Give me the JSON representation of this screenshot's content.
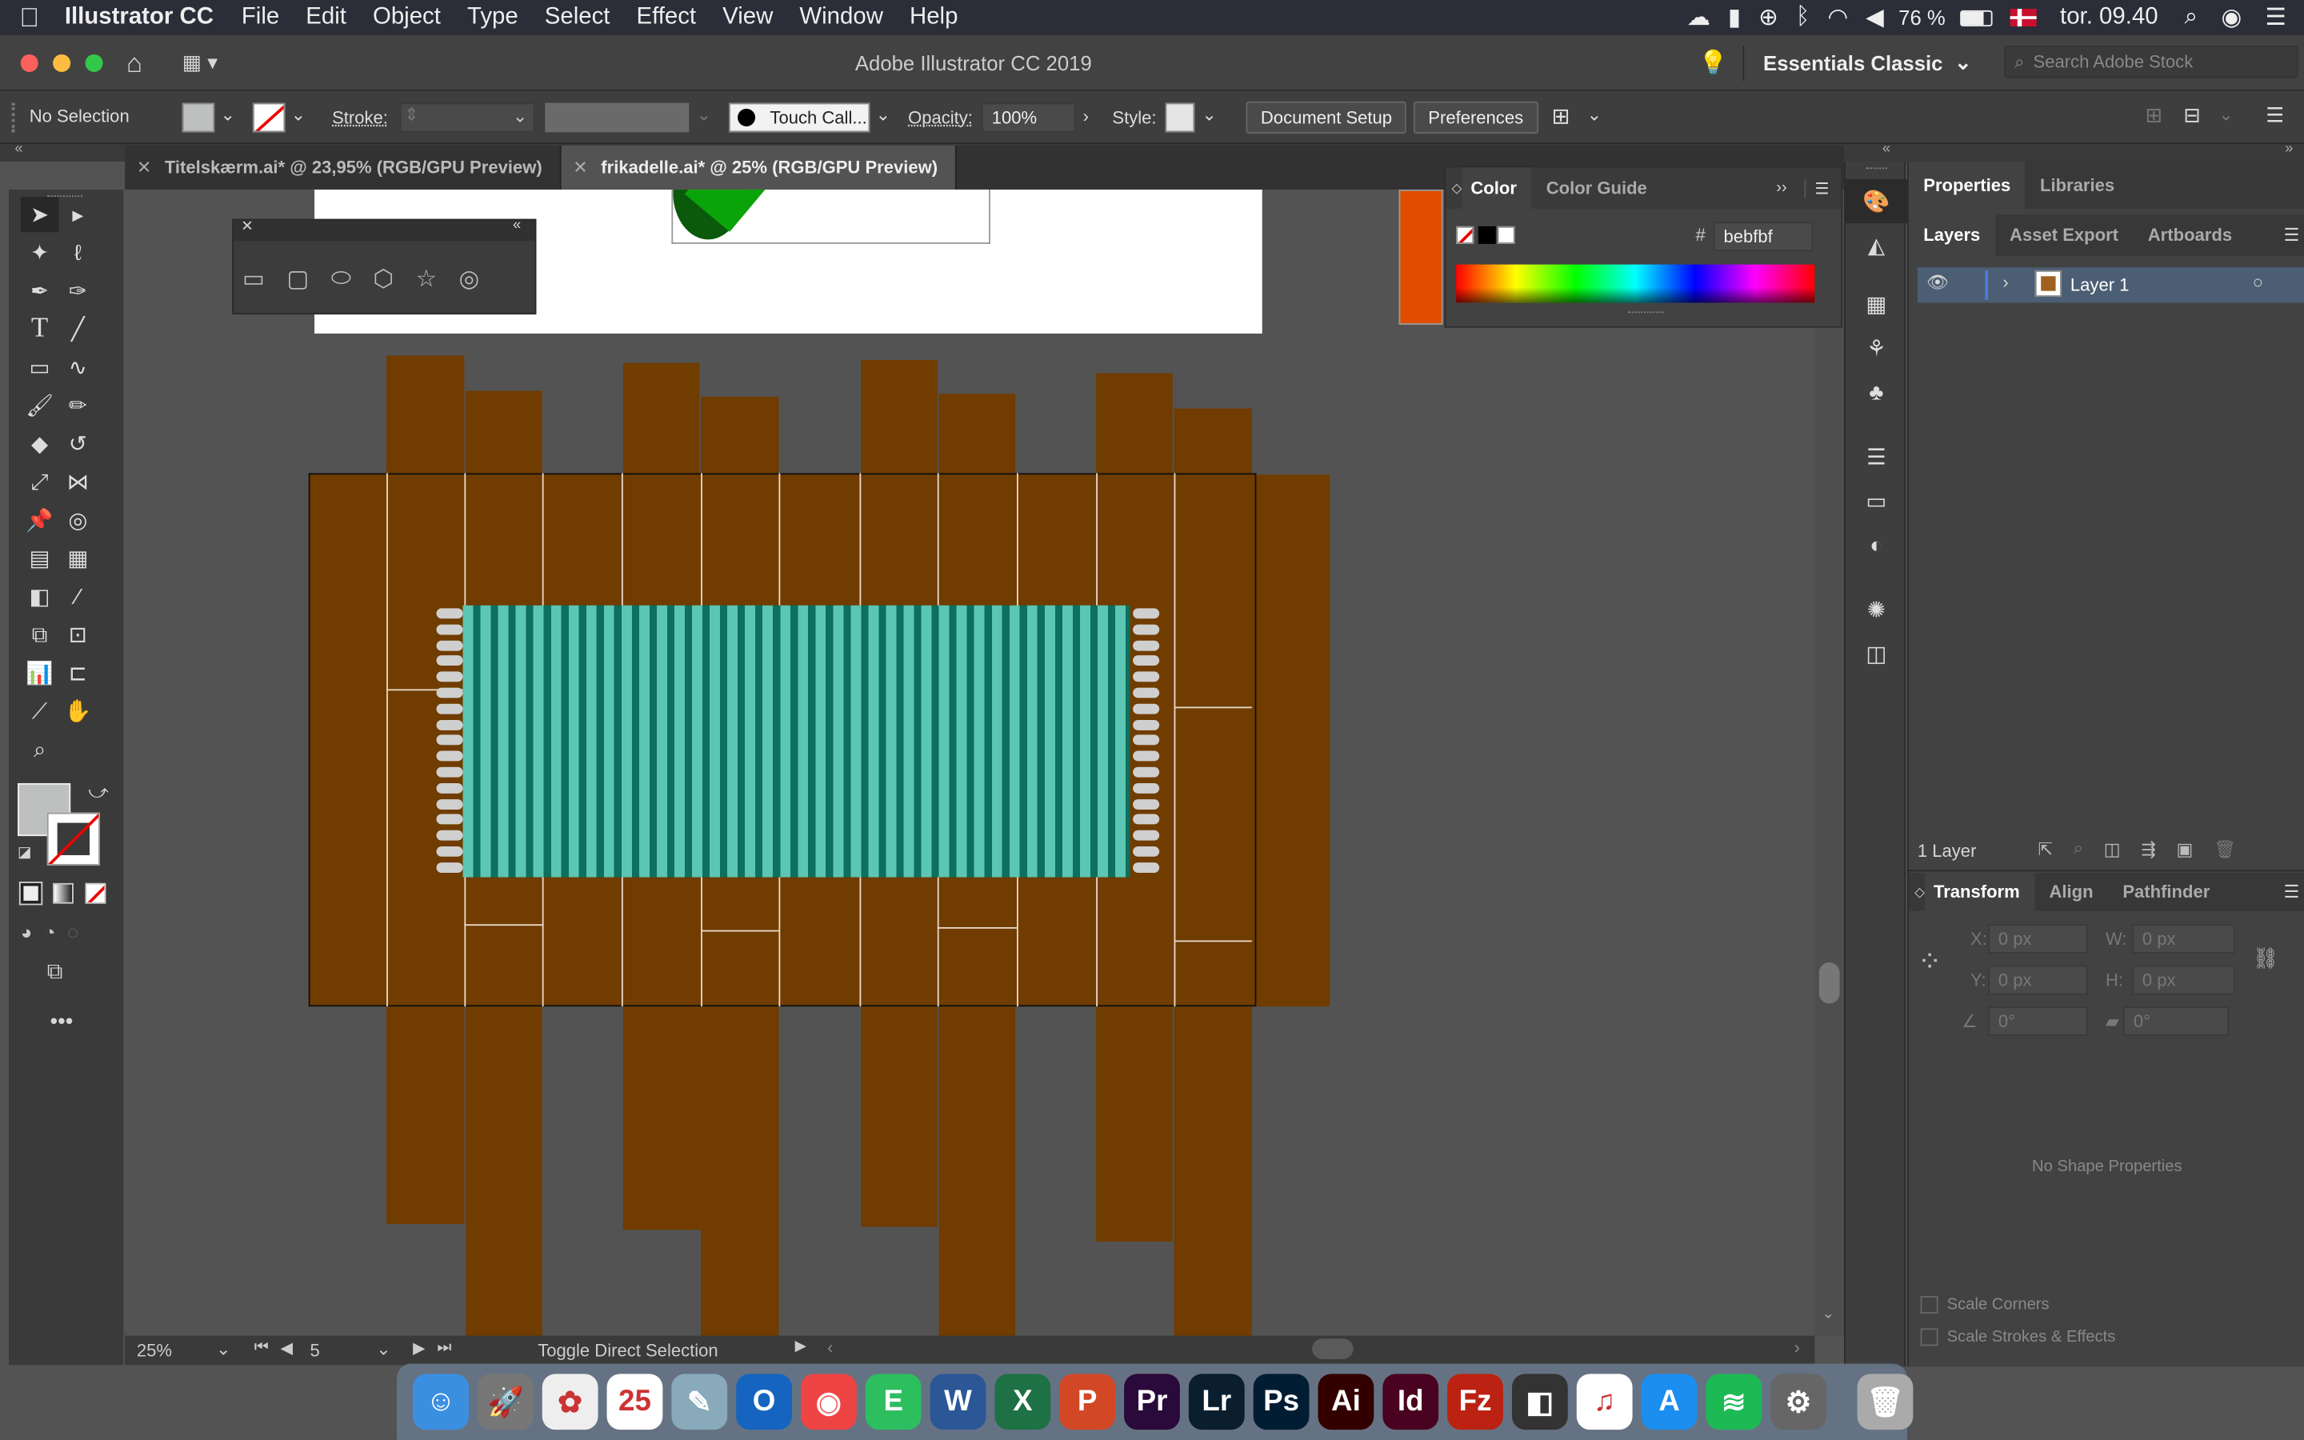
{
  "menubar": {
    "app": "Illustrator CC",
    "items": [
      "File",
      "Edit",
      "Object",
      "Type",
      "Select",
      "Effect",
      "View",
      "Window",
      "Help"
    ],
    "battery": "76 %",
    "clock": "tor. 09.40"
  },
  "appbar": {
    "title": "Adobe Illustrator CC 2019",
    "workspace": "Essentials Classic",
    "search_placeholder": "Search Adobe Stock"
  },
  "control": {
    "selection": "No Selection",
    "stroke_label": "Stroke:",
    "brush": "Touch Call...",
    "opacity_label": "Opacity:",
    "opacity": "100%",
    "style_label": "Style:",
    "document_setup": "Document Setup",
    "preferences": "Preferences"
  },
  "tabs": [
    {
      "label": "Titelskærm.ai* @ 23,95% (RGB/GPU Preview)"
    },
    {
      "label": "frikadelle.ai* @ 25% (RGB/GPU Preview)"
    }
  ],
  "color_panel": {
    "tab_color": "Color",
    "tab_guide": "Color Guide",
    "hash": "#",
    "hex": "bebfbf"
  },
  "right_panel": {
    "tabs": [
      "Properties",
      "Libraries"
    ],
    "subtabs": [
      "Layers",
      "Asset Export",
      "Artboards"
    ],
    "layer_name": "Layer 1",
    "layer_count": "1 Layer"
  },
  "transform": {
    "tabs": [
      "Transform",
      "Align",
      "Pathfinder"
    ],
    "x_label": "X:",
    "x": "0 px",
    "y_label": "Y:",
    "y": "0 px",
    "w_label": "W:",
    "w": "0 px",
    "h_label": "H:",
    "h": "0 px",
    "angle": "0°",
    "shear": "0°",
    "no_props": "No Shape Properties",
    "scale_corners": "Scale Corners",
    "scale_strokes": "Scale Strokes & Effects"
  },
  "status": {
    "zoom": "25%",
    "artboard": "5",
    "message": "Toggle Direct Selection"
  },
  "dock": [
    {
      "name": "finder",
      "label": "☺",
      "color": "#3b8fe0"
    },
    {
      "name": "launchpad",
      "label": "🚀",
      "color": "#777"
    },
    {
      "name": "photos",
      "label": "✿",
      "color": "#eee"
    },
    {
      "name": "calendar",
      "label": "25",
      "color": "#fff"
    },
    {
      "name": "preview",
      "label": "✎",
      "color": "#8ab"
    },
    {
      "name": "outlook",
      "label": "O",
      "color": "#1565c0"
    },
    {
      "name": "chrome",
      "label": "◉",
      "color": "#e44"
    },
    {
      "name": "evernote",
      "label": "E",
      "color": "#2dbe60"
    },
    {
      "name": "word",
      "label": "W",
      "color": "#2b5797"
    },
    {
      "name": "excel",
      "label": "X",
      "color": "#1e7145"
    },
    {
      "name": "powerpoint",
      "label": "P",
      "color": "#d24726"
    },
    {
      "name": "premiere",
      "label": "Pr",
      "color": "#2a0a3a"
    },
    {
      "name": "lightroom",
      "label": "Lr",
      "color": "#0a1e2e"
    },
    {
      "name": "photoshop",
      "label": "Ps",
      "color": "#001d33"
    },
    {
      "name": "illustrator",
      "label": "Ai",
      "color": "#330000"
    },
    {
      "name": "indesign",
      "label": "Id",
      "color": "#49021f"
    },
    {
      "name": "filezilla",
      "label": "Fz",
      "color": "#b21"
    },
    {
      "name": "unknown",
      "label": "◧",
      "color": "#333"
    },
    {
      "name": "itunes",
      "label": "♫",
      "color": "#fff"
    },
    {
      "name": "appstore",
      "label": "A",
      "color": "#1b8ef0"
    },
    {
      "name": "spotify",
      "label": "≋",
      "color": "#1db954"
    },
    {
      "name": "system-preferences",
      "label": "⚙",
      "color": "#666"
    },
    {
      "name": "trash",
      "label": "🗑",
      "color": "#aaa"
    }
  ],
  "colors": {
    "wood": "#703c00",
    "rug_light": "#5bc6b4",
    "rug_dark": "#0d6f5d",
    "fringe": "#cfcfcf",
    "orange": "#e04c00"
  }
}
